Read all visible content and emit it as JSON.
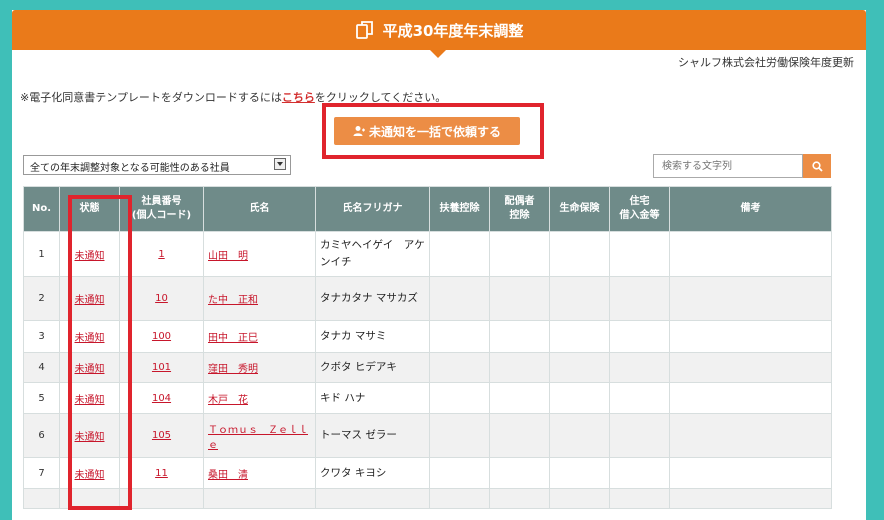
{
  "header": {
    "title": "平成30年度年末調整"
  },
  "company": {
    "label": "シャルフ株式会社労働保険年度更新"
  },
  "notice": {
    "prefix": "※電子化同意書テンプレートをダウンロードするには",
    "link": "こちら",
    "suffix": "をクリックしてください。"
  },
  "request_button": {
    "label": "未通知を一括で依頼する"
  },
  "filter": {
    "selected": "全ての年末調整対象となる可能性のある社員"
  },
  "search": {
    "placeholder": "検索する文字列"
  },
  "colors": {
    "header": "#ea7a1a",
    "button": "#ec8d45",
    "table_header": "#6f8b89",
    "link": "#c7162b",
    "highlight": "#e0242d"
  },
  "table": {
    "headers": {
      "no": "No.",
      "status": "状態",
      "id_line1": "社員番号",
      "id_line2": "(個人コード)",
      "name": "氏名",
      "kana": "氏名フリガナ",
      "dependents": "扶養控除",
      "spouse_line1": "配偶者",
      "spouse_line2": "控除",
      "life_insurance": "生命保険",
      "housing_line1": "住宅",
      "housing_line2": "借入金等",
      "notes": "備考"
    },
    "rows": [
      {
        "no": "1",
        "status": "未通知",
        "id": "1",
        "name": "山田　明",
        "kana": "カミヤヘイゲイ　アケンイチ"
      },
      {
        "no": "2",
        "status": "未通知",
        "id": "10",
        "name": "た中　正和",
        "kana": "タナカタナ マサカズ"
      },
      {
        "no": "3",
        "status": "未通知",
        "id": "100",
        "name": "田中　正巳",
        "kana": "タナカ マサミ"
      },
      {
        "no": "4",
        "status": "未通知",
        "id": "101",
        "name": "窪田　秀明",
        "kana": "クボタ ヒデアキ"
      },
      {
        "no": "5",
        "status": "未通知",
        "id": "104",
        "name": "木戸　花",
        "kana": "キド ハナ"
      },
      {
        "no": "6",
        "status": "未通知",
        "id": "105",
        "name": "Ｔｏｍｕｓ　Ｚｅｌｌｅ",
        "kana": "トーマス ゼラー"
      },
      {
        "no": "7",
        "status": "未通知",
        "id": "11",
        "name": "桑田　清",
        "kana": "クワタ キヨシ"
      }
    ]
  }
}
